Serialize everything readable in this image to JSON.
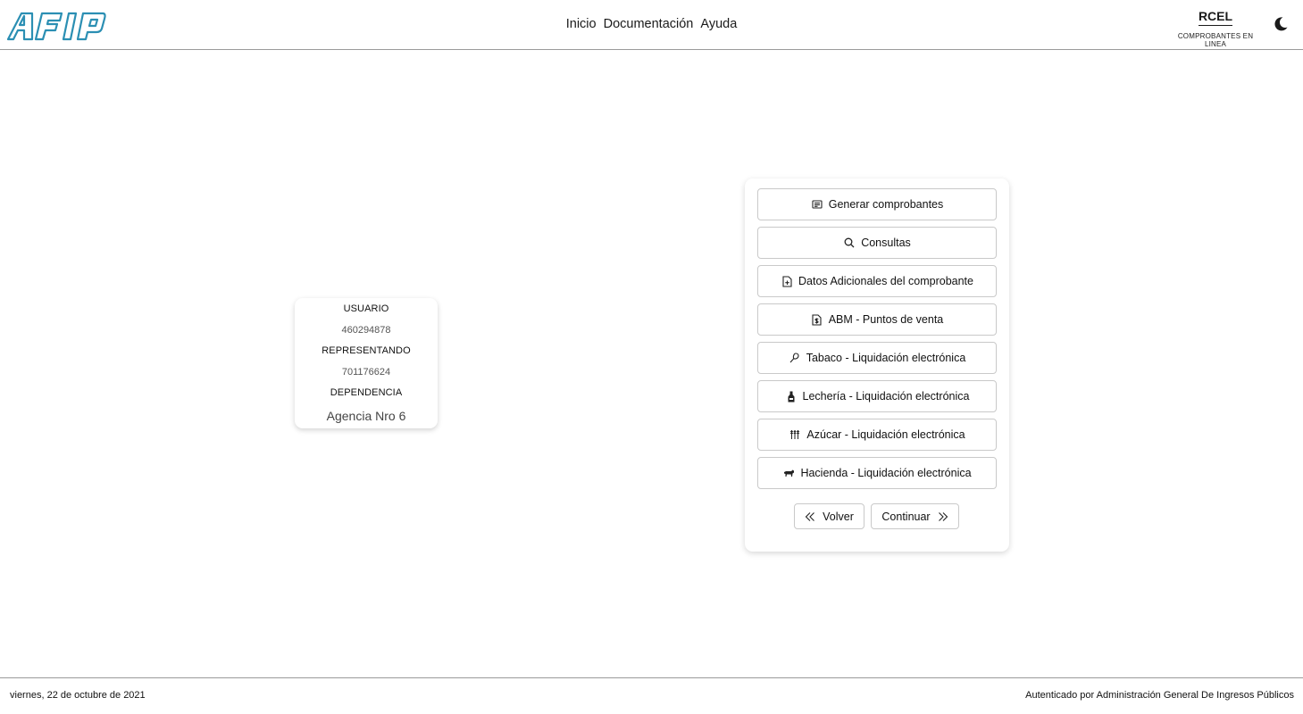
{
  "header": {
    "logo_text": "AFIP",
    "nav": [
      "Inicio",
      "Documentación",
      "Ayuda"
    ],
    "brand_name": "RCEL",
    "brand_subtitle": "COMPROBANTES EN LINEA",
    "theme_icon": "moon-icon"
  },
  "user_card": {
    "usuario_label": "USUARIO",
    "usuario_value": "460294878",
    "representando_label": "REPRESENTANDO",
    "representando_value": "701176624",
    "dependencia_label": "DEPENDENCIA",
    "dependencia_value": "Agencia Nro 6"
  },
  "menu": {
    "items": [
      {
        "label": "Generar comprobantes",
        "icon": "document-list-icon"
      },
      {
        "label": "Consultas",
        "icon": "search-icon"
      },
      {
        "label": "Datos Adicionales del comprobante",
        "icon": "file-add-icon"
      },
      {
        "label": "ABM - Puntos de venta",
        "icon": "file-dollar-icon"
      },
      {
        "label": "Tabaco - Liquidación electrónica",
        "icon": "leaf-icon"
      },
      {
        "label": "Lechería - Liquidación electrónica",
        "icon": "milk-bottle-icon"
      },
      {
        "label": "Azúcar - Liquidación electrónica",
        "icon": "wheat-icon"
      },
      {
        "label": "Hacienda - Liquidación electrónica",
        "icon": "cattle-icon"
      }
    ],
    "back_label": "Volver",
    "continue_label": "Continuar"
  },
  "footer": {
    "date": "viernes, 22 de octubre de 2021",
    "auth": "Autenticado por Administración General De Ingresos Públicos"
  }
}
